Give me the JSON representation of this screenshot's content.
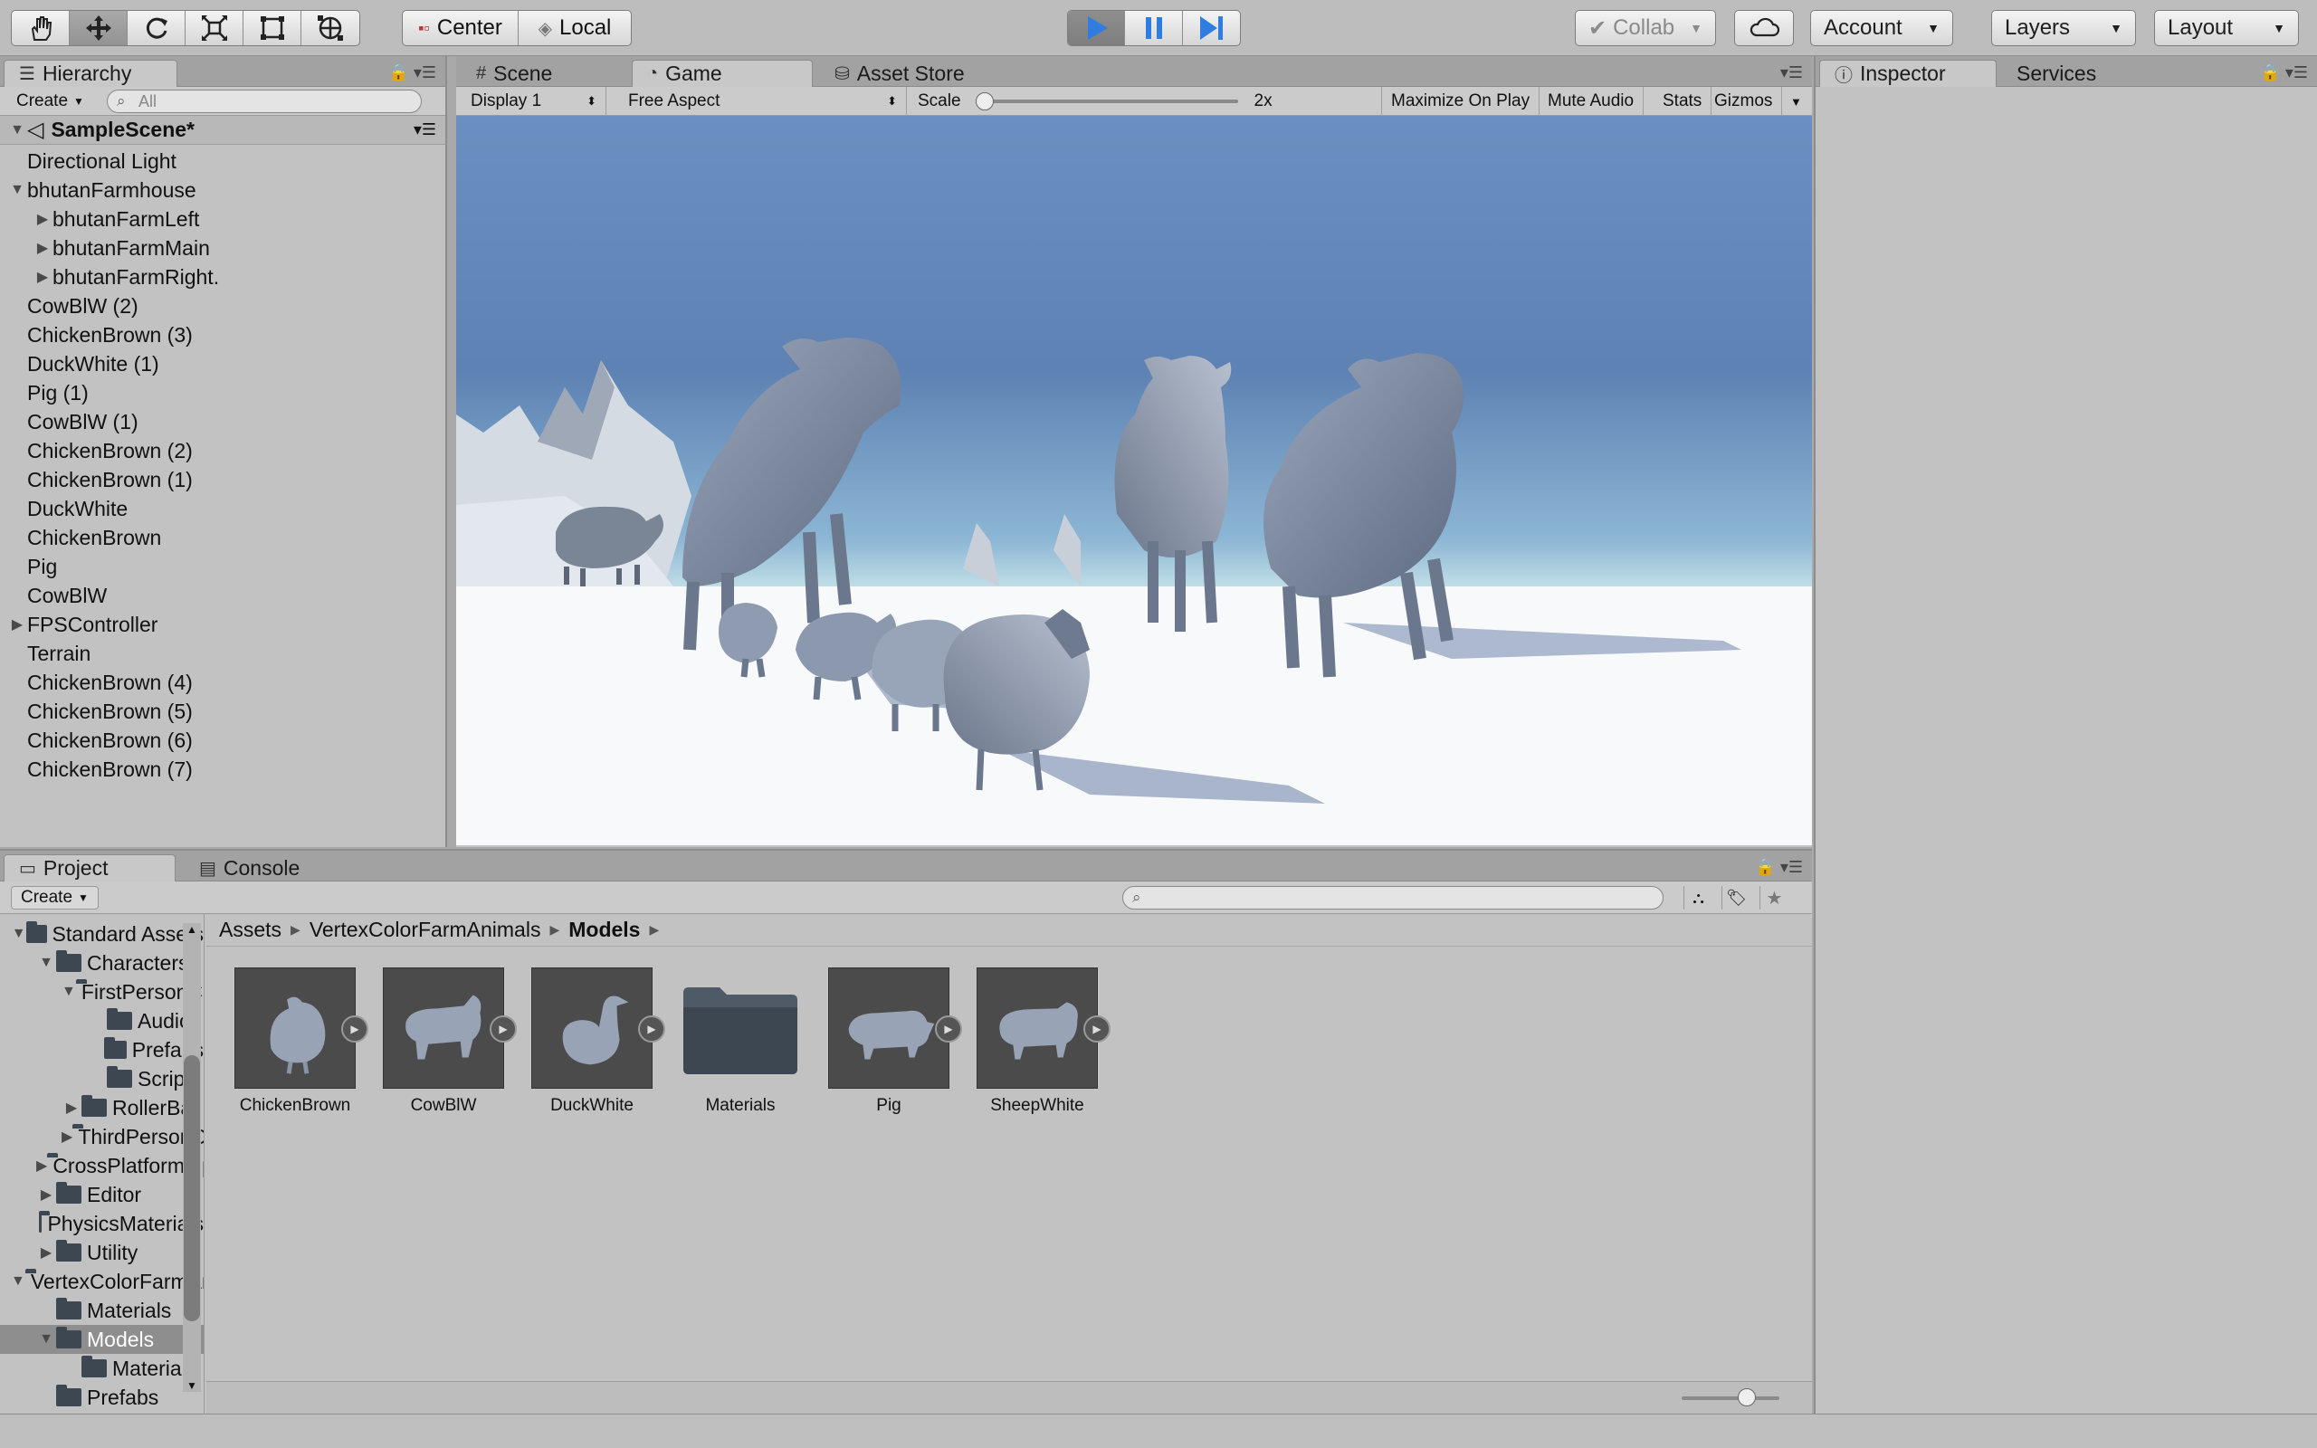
{
  "toolbar": {
    "tools": [
      "hand-tool",
      "move-tool",
      "rotate-tool",
      "scale-tool",
      "rect-tool",
      "transform-tool"
    ],
    "pivot_mode": "Center",
    "pivot_space": "Local",
    "collab_label": "Collab",
    "account_label": "Account",
    "layers_label": "Layers",
    "layout_label": "Layout"
  },
  "hierarchy": {
    "tab_label": "Hierarchy",
    "create_label": "Create",
    "search_placeholder": "All",
    "scene_name": "SampleScene*",
    "items": [
      {
        "label": "Directional Light",
        "indent": 0,
        "arrow": ""
      },
      {
        "label": "bhutanFarmhouse",
        "indent": 0,
        "arrow": "▼"
      },
      {
        "label": "bhutanFarmLeft",
        "indent": 1,
        "arrow": "▶"
      },
      {
        "label": "bhutanFarmMain",
        "indent": 1,
        "arrow": "▶"
      },
      {
        "label": "bhutanFarmRight.",
        "indent": 1,
        "arrow": "▶"
      },
      {
        "label": "CowBlW (2)",
        "indent": 0,
        "arrow": ""
      },
      {
        "label": "ChickenBrown (3)",
        "indent": 0,
        "arrow": ""
      },
      {
        "label": "DuckWhite (1)",
        "indent": 0,
        "arrow": ""
      },
      {
        "label": "Pig (1)",
        "indent": 0,
        "arrow": ""
      },
      {
        "label": "CowBlW (1)",
        "indent": 0,
        "arrow": ""
      },
      {
        "label": "ChickenBrown (2)",
        "indent": 0,
        "arrow": ""
      },
      {
        "label": "ChickenBrown (1)",
        "indent": 0,
        "arrow": ""
      },
      {
        "label": "DuckWhite",
        "indent": 0,
        "arrow": ""
      },
      {
        "label": "ChickenBrown",
        "indent": 0,
        "arrow": ""
      },
      {
        "label": "Pig",
        "indent": 0,
        "arrow": ""
      },
      {
        "label": "CowBlW",
        "indent": 0,
        "arrow": ""
      },
      {
        "label": "FPSController",
        "indent": 0,
        "arrow": "▶"
      },
      {
        "label": "Terrain",
        "indent": 0,
        "arrow": ""
      },
      {
        "label": "ChickenBrown (4)",
        "indent": 0,
        "arrow": ""
      },
      {
        "label": "ChickenBrown (5)",
        "indent": 0,
        "arrow": ""
      },
      {
        "label": "ChickenBrown (6)",
        "indent": 0,
        "arrow": ""
      },
      {
        "label": "ChickenBrown (7)",
        "indent": 0,
        "arrow": ""
      }
    ]
  },
  "center_tabs": {
    "scene": "Scene",
    "game": "Game",
    "asset_store": "Asset Store"
  },
  "game_view": {
    "display": "Display 1",
    "aspect": "Free Aspect",
    "scale_label": "Scale",
    "scale_value": "2x",
    "scale_fraction": 0.0,
    "maximize": "Maximize On Play",
    "mute": "Mute Audio",
    "stats": "Stats",
    "gizmos": "Gizmos"
  },
  "right_tabs": {
    "inspector": "Inspector",
    "services": "Services"
  },
  "project": {
    "tab_label": "Project",
    "console_label": "Console",
    "create_label": "Create",
    "tree": [
      {
        "label": "Standard Assets",
        "indent": 0,
        "arrow": "▼",
        "sel": false
      },
      {
        "label": "Characters",
        "indent": 1,
        "arrow": "▼",
        "sel": false
      },
      {
        "label": "FirstPersonCharacter",
        "indent": 2,
        "arrow": "▼",
        "sel": false
      },
      {
        "label": "Audio",
        "indent": 3,
        "arrow": "",
        "sel": false
      },
      {
        "label": "Prefabs",
        "indent": 3,
        "arrow": "",
        "sel": false
      },
      {
        "label": "Scripts",
        "indent": 3,
        "arrow": "",
        "sel": false
      },
      {
        "label": "RollerBall",
        "indent": 2,
        "arrow": "▶",
        "sel": false
      },
      {
        "label": "ThirdPersonCharacter",
        "indent": 2,
        "arrow": "▶",
        "sel": false
      },
      {
        "label": "CrossPlatformInput",
        "indent": 1,
        "arrow": "▶",
        "sel": false
      },
      {
        "label": "Editor",
        "indent": 1,
        "arrow": "▶",
        "sel": false
      },
      {
        "label": "PhysicsMaterials",
        "indent": 1,
        "arrow": "",
        "sel": false
      },
      {
        "label": "Utility",
        "indent": 1,
        "arrow": "▶",
        "sel": false
      },
      {
        "label": "VertexColorFarmAnimals",
        "indent": 0,
        "arrow": "▼",
        "sel": false
      },
      {
        "label": "Materials",
        "indent": 1,
        "arrow": "",
        "sel": false
      },
      {
        "label": "Models",
        "indent": 1,
        "arrow": "▼",
        "sel": true
      },
      {
        "label": "Materials",
        "indent": 2,
        "arrow": "",
        "sel": false
      },
      {
        "label": "Prefabs",
        "indent": 1,
        "arrow": "",
        "sel": false
      }
    ],
    "breadcrumb": [
      "Assets",
      "VertexColorFarmAnimals",
      "Models"
    ],
    "assets": [
      {
        "label": "ChickenBrown",
        "kind": "model",
        "icon": "chicken-icon"
      },
      {
        "label": "CowBlW",
        "kind": "model",
        "icon": "cow-icon"
      },
      {
        "label": "DuckWhite",
        "kind": "model",
        "icon": "duck-icon"
      },
      {
        "label": "Materials",
        "kind": "folder",
        "icon": "folder-icon"
      },
      {
        "label": "Pig",
        "kind": "model",
        "icon": "pig-icon"
      },
      {
        "label": "SheepWhite",
        "kind": "model",
        "icon": "sheep-icon"
      }
    ],
    "zoom_fraction": 0.7
  },
  "colors": {
    "play_active": "#2f7de1",
    "folder": "#3d4751",
    "sky_top": "#5f85b8",
    "sky_horizon": "#b7dbe2"
  }
}
